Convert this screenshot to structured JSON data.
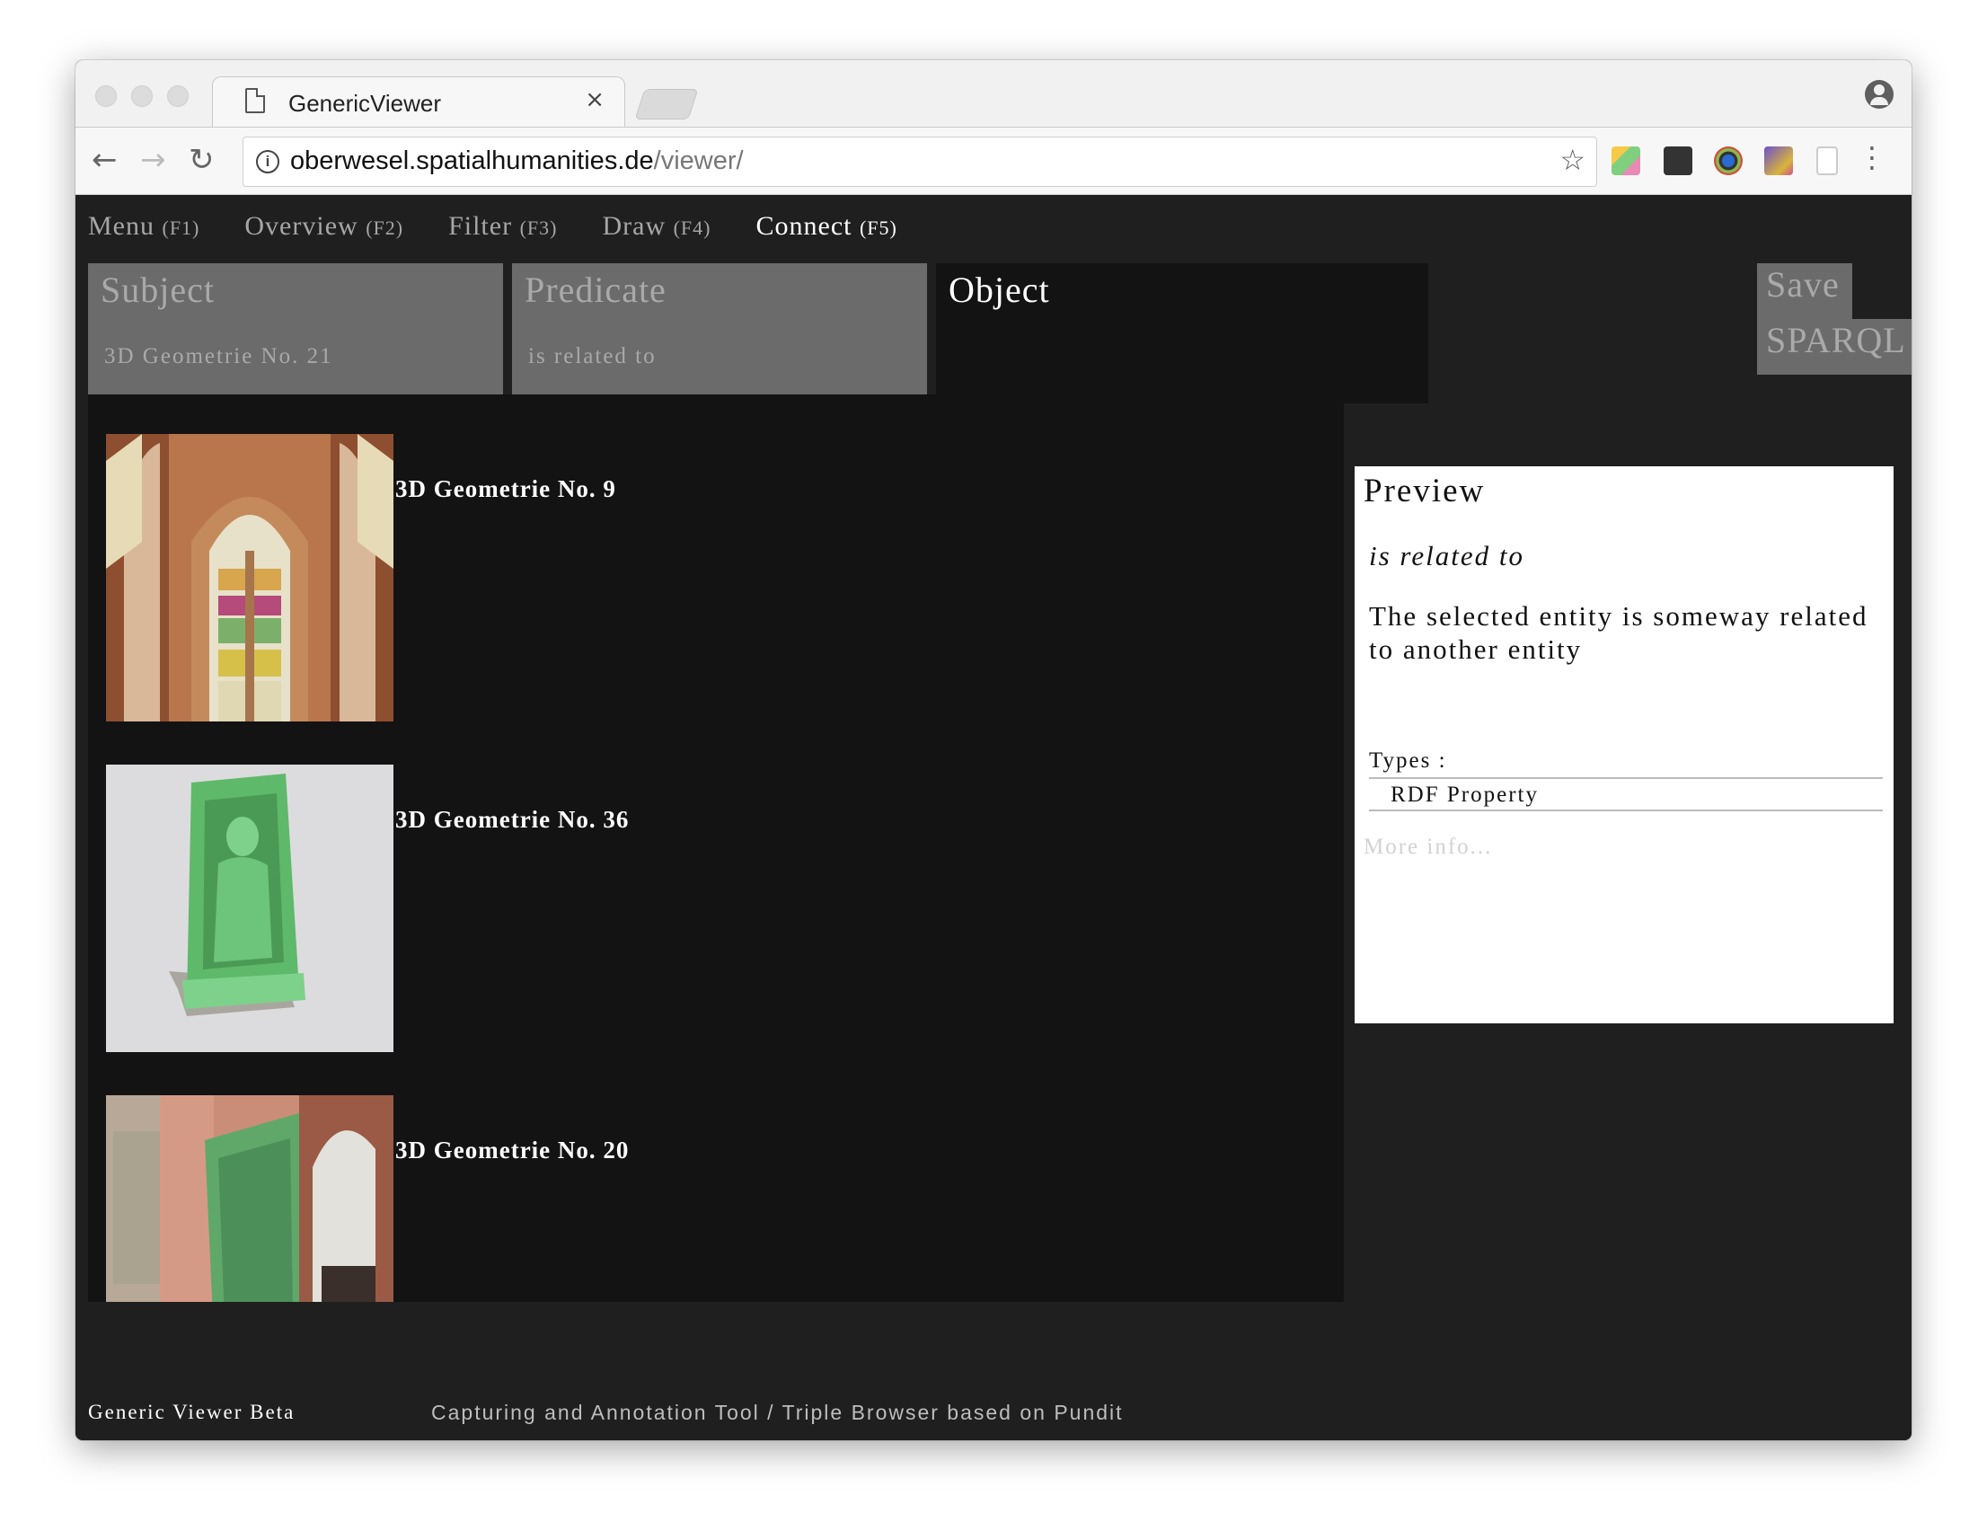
{
  "browser": {
    "tab_title": "GenericViewer",
    "tab_close": "×",
    "url_host": "oberwesel.spatialhumanities.de",
    "url_path": "/viewer/",
    "nav_back": "←",
    "nav_forward": "→",
    "nav_reload": "↻",
    "info_glyph": "i",
    "star_glyph": "☆",
    "menu_glyph": "⋮"
  },
  "app": {
    "nav": [
      {
        "label": "Menu",
        "key": "(F1)"
      },
      {
        "label": "Overview",
        "key": "(F2)"
      },
      {
        "label": "Filter",
        "key": "(F3)"
      },
      {
        "label": "Draw",
        "key": "(F4)"
      },
      {
        "label": "Connect",
        "key": "(F5)"
      }
    ],
    "active_nav": "Connect",
    "subject": {
      "heading": "Subject",
      "value": "3D Geometrie No. 21"
    },
    "predicate": {
      "heading": "Predicate",
      "value": "is related to"
    },
    "object": {
      "heading": "Object"
    },
    "save_label": "Save",
    "sparql_label": "SPARQL",
    "results": [
      {
        "label": "3D Geometrie No. 9"
      },
      {
        "label": "3D Geometrie No. 36"
      },
      {
        "label": "3D Geometrie No. 20"
      }
    ],
    "preview": {
      "title": "Preview",
      "predicate": "is related to",
      "description": "The selected entity is someway related to another entity",
      "types_label": "Types :",
      "types_value": "RDF Property",
      "more_info": "More info..."
    },
    "footer": {
      "left": "Generic Viewer Beta",
      "right": "Capturing and Annotation Tool / Triple Browser based on Pundit"
    }
  },
  "colors": {
    "page_bg": "#1f1f1f",
    "panel_bg": "#131313",
    "slot_bg": "#6b6b6b",
    "slot_text": "#a9a9a9",
    "preview_bg": "#ffffff"
  }
}
